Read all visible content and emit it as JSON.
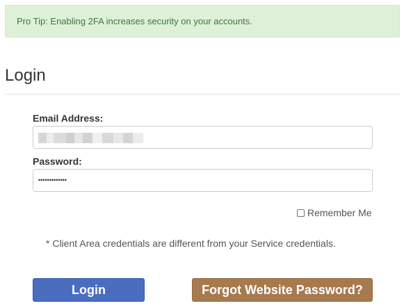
{
  "alert": {
    "text": "Pro Tip: Enabling 2FA increases security on your accounts."
  },
  "page": {
    "title": "Login"
  },
  "form": {
    "email_label": "Email Address:",
    "email_value_obscured": true,
    "password_label": "Password:",
    "password_mask": "•••••••••••••",
    "remember_label": "Remember Me",
    "remember_checked": false,
    "note": "* Client Area credentials are different from your Service credentials."
  },
  "buttons": {
    "login_label": "Login",
    "forgot_label": "Forgot Website Password?"
  },
  "colors": {
    "alert_bg": "#dff0d8",
    "alert_text": "#3c763d",
    "login_button": "#4a6dbf",
    "forgot_button": "#a77a4e"
  }
}
